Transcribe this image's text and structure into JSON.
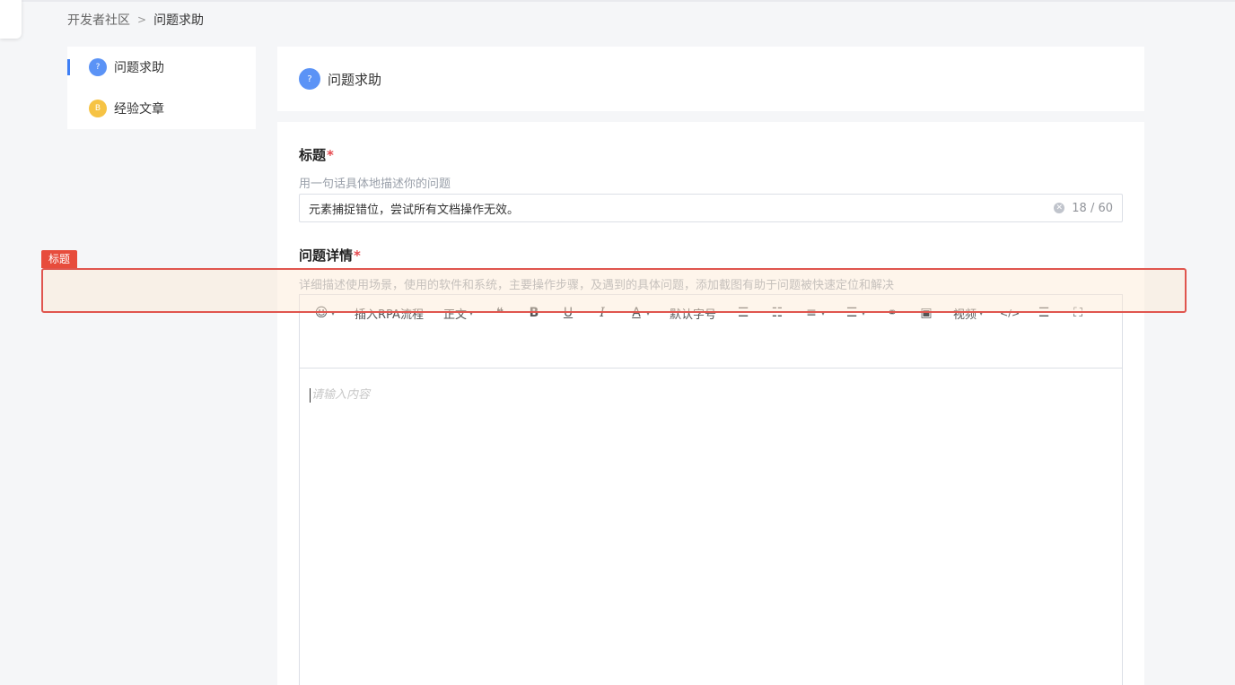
{
  "breadcrumb": {
    "root": "开发者社区",
    "separator": ">",
    "current": "问题求助"
  },
  "sidebar": {
    "items": [
      {
        "label": "问题求助",
        "badge": "?",
        "active": true
      },
      {
        "label": "经验文章",
        "badge": "B",
        "active": false
      }
    ]
  },
  "header": {
    "badge": "?",
    "title": "问题求助"
  },
  "form": {
    "title_label": "标题",
    "required_mark": "*",
    "title_hint": "用一句话具体地描述你的问题",
    "title_value": "元素捕捉错位，尝试所有文档操作无效。",
    "title_counter": "18 / 60",
    "detail_label": "问题详情",
    "detail_hint": "详细描述使用场景，使用的软件和系统，主要操作步骤，及遇到的具体问题，添加截图有助于问题被快速定位和解决",
    "editor_placeholder": "请输入内容"
  },
  "toolbar": {
    "insert_rpa": "插入RPA流程",
    "paragraph": "正文",
    "font_size": "默认字号",
    "video": "视频"
  },
  "annotation": {
    "tag": "标题"
  },
  "colors": {
    "accent": "#3e7ff5",
    "highlight_border": "#e0554e",
    "tag_bg": "#e74c3c",
    "required": "#e5484d"
  }
}
